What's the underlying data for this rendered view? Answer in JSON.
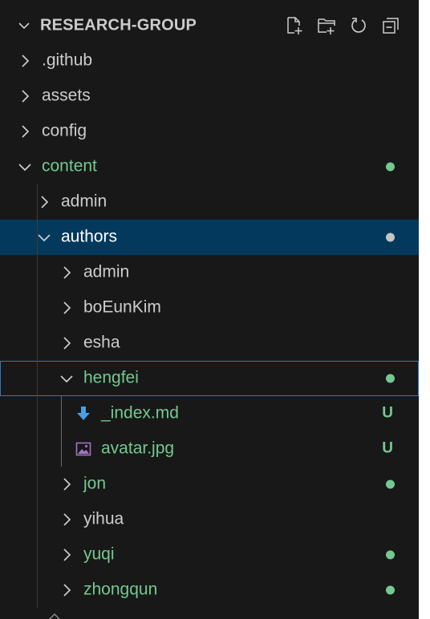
{
  "explorer": {
    "title": "RESEARCH-GROUP",
    "actions": [
      {
        "icon": "new-file-icon"
      },
      {
        "icon": "new-folder-icon"
      },
      {
        "icon": "refresh-icon"
      },
      {
        "icon": "collapse-all-icon"
      }
    ]
  },
  "colors": {
    "background": "#181818",
    "text": "#cccccc",
    "untracked": "#73c991",
    "selected_bg": "#04395e",
    "focus_border": "#2b79d0",
    "dot_selected": "#c5c5c5"
  },
  "tree": [
    {
      "label": ".github",
      "type": "folder",
      "expanded": false,
      "depth": 0,
      "status": ""
    },
    {
      "label": "assets",
      "type": "folder",
      "expanded": false,
      "depth": 0,
      "status": ""
    },
    {
      "label": "config",
      "type": "folder",
      "expanded": false,
      "depth": 0,
      "status": ""
    },
    {
      "label": "content",
      "type": "folder",
      "expanded": true,
      "depth": 0,
      "status": "dot"
    },
    {
      "label": "admin",
      "type": "folder",
      "expanded": false,
      "depth": 1,
      "status": ""
    },
    {
      "label": "authors",
      "type": "folder",
      "expanded": true,
      "depth": 1,
      "status": "dot",
      "selected": true
    },
    {
      "label": "admin",
      "type": "folder",
      "expanded": false,
      "depth": 2,
      "status": ""
    },
    {
      "label": "boEunKim",
      "type": "folder",
      "expanded": false,
      "depth": 2,
      "status": ""
    },
    {
      "label": "esha",
      "type": "folder",
      "expanded": false,
      "depth": 2,
      "status": ""
    },
    {
      "label": "hengfei",
      "type": "folder",
      "expanded": true,
      "depth": 2,
      "status": "dot",
      "focused": true
    },
    {
      "label": "_index.md",
      "type": "file",
      "icon": "markdown-arrow-icon",
      "depth": 3,
      "status": "U"
    },
    {
      "label": "avatar.jpg",
      "type": "file",
      "icon": "image-icon",
      "depth": 3,
      "status": "U"
    },
    {
      "label": "jon",
      "type": "folder",
      "expanded": false,
      "depth": 2,
      "status": "dot"
    },
    {
      "label": "yihua",
      "type": "folder",
      "expanded": false,
      "depth": 2,
      "status": ""
    },
    {
      "label": "yuqi",
      "type": "folder",
      "expanded": false,
      "depth": 2,
      "status": "dot"
    },
    {
      "label": "zhongqun",
      "type": "folder",
      "expanded": false,
      "depth": 2,
      "status": "dot"
    }
  ]
}
